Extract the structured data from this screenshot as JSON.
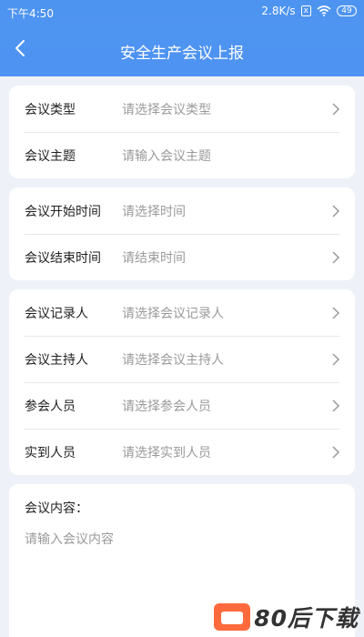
{
  "status_bar": {
    "time": "下午4:50",
    "network_speed": "2.8K/s",
    "sim_badge": "x",
    "battery": "49"
  },
  "header": {
    "title": "安全生产会议上报",
    "back_icon": "chevron-left-icon"
  },
  "cards": [
    {
      "rows": [
        {
          "label": "会议类型",
          "placeholder": "请选择会议类型",
          "has_arrow": true
        },
        {
          "label": "会议主题",
          "placeholder": "请输入会议主题",
          "has_arrow": false
        }
      ]
    },
    {
      "rows": [
        {
          "label": "会议开始时间",
          "placeholder": "请选择时间",
          "has_arrow": true
        },
        {
          "label": "会议结束时间",
          "placeholder": "请结束时间",
          "has_arrow": true
        }
      ]
    },
    {
      "rows": [
        {
          "label": "会议记录人",
          "placeholder": "请选择会议记录人",
          "has_arrow": true
        },
        {
          "label": "会议主持人",
          "placeholder": "请选择会议主持人",
          "has_arrow": true
        },
        {
          "label": "参会人员",
          "placeholder": "请选择参会人员",
          "has_arrow": true
        },
        {
          "label": "实到人员",
          "placeholder": "请选择实到人员",
          "has_arrow": true
        }
      ]
    }
  ],
  "content": {
    "label": "会议内容：",
    "placeholder": "请输入会议内容"
  },
  "watermark": {
    "text": "80后下载"
  },
  "colors": {
    "header": "#4f93f2",
    "background": "#eef2f8",
    "label": "#222222",
    "placeholder": "#9a9a9a"
  }
}
